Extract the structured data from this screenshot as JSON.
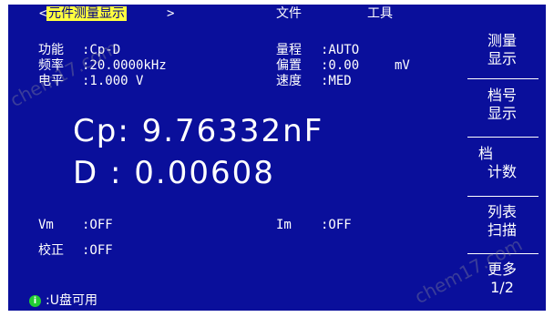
{
  "menu": {
    "left_arrow": "<",
    "active": "元件测量显示",
    "right_arrow": ">",
    "file": "文件",
    "tools": "工具"
  },
  "params": {
    "function_label": "功能",
    "function_value": ":Cp-D",
    "frequency_label": "频率",
    "frequency_value": ":20.0000kHz",
    "level_label": "电平",
    "level_value": ":1.000 V",
    "range_label": "量程",
    "range_value": ":AUTO",
    "bias_label": "偏置",
    "bias_value": ":0.00",
    "bias_unit": "mV",
    "speed_label": "速度",
    "speed_value": ":MED"
  },
  "readings": {
    "primary": "Cp: 9.76332nF",
    "secondary": "D : 0.00608"
  },
  "monitor": {
    "vm_label": "Vm",
    "vm_value": ":OFF",
    "im_label": "Im",
    "im_value": ":OFF",
    "correction_label": "校正",
    "correction_value": ":OFF"
  },
  "softkeys": [
    {
      "line1": "测量",
      "line2": "显示"
    },
    {
      "line1": "档号",
      "line2": "显示"
    },
    {
      "line1": "档",
      "line2": "计数"
    },
    {
      "line1": "列表",
      "line2": "扫描"
    },
    {
      "line1": "更多",
      "line2": "1/2"
    }
  ],
  "status": {
    "icon": "info-icon",
    "icon_glyph": "i",
    "text": ":U盘可用"
  },
  "watermark": "chem17.com"
}
